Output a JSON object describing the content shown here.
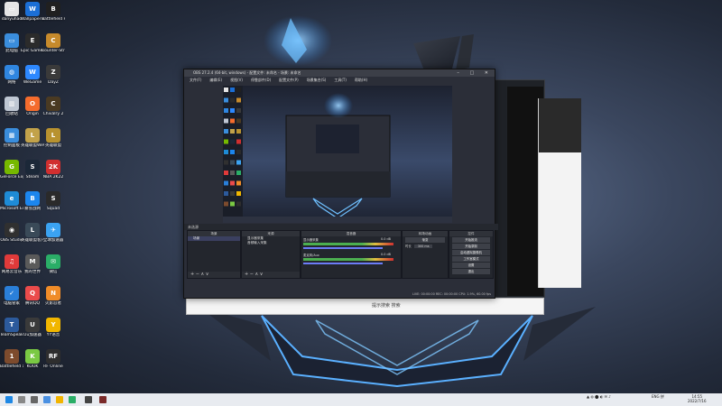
{
  "desktop": {
    "icons": [
      {
        "label": "danyuhao",
        "color": "#e5e5e5",
        "glyph": "▭"
      },
      {
        "label": "Wallpaper Engine",
        "color": "#1b6fd6",
        "glyph": "W"
      },
      {
        "label": "Battlefield Recruiter",
        "color": "#202020",
        "glyph": "B"
      },
      {
        "label": "此电脑",
        "color": "#3a8ddc",
        "glyph": "▭"
      },
      {
        "label": "Epic Games Launcher",
        "color": "#2b2b2b",
        "glyph": "E"
      },
      {
        "label": "Counter-Strike Global Off",
        "color": "#c68a2c",
        "glyph": "C"
      },
      {
        "label": "网络",
        "color": "#2f86e0",
        "glyph": "◍"
      },
      {
        "label": "WeGame",
        "color": "#2d88ff",
        "glyph": "W"
      },
      {
        "label": "DayZ",
        "color": "#3a3a3a",
        "glyph": "Z"
      },
      {
        "label": "回收站",
        "color": "#bfc7d3",
        "glyph": "▥"
      },
      {
        "label": "Origin",
        "color": "#f56c2d",
        "glyph": "O"
      },
      {
        "label": "Chivalry 2",
        "color": "#4a3a22",
        "glyph": "C"
      },
      {
        "label": "控制面板",
        "color": "#3a8ddc",
        "glyph": "▦"
      },
      {
        "label": "英雄联盟WeGame版",
        "color": "#c2a24a",
        "glyph": "L"
      },
      {
        "label": "英雄联盟",
        "color": "#b8922f",
        "glyph": "L"
      },
      {
        "label": "GeForce Experience",
        "color": "#76b900",
        "glyph": "G"
      },
      {
        "label": "Steam",
        "color": "#1b2838",
        "glyph": "S"
      },
      {
        "label": "NBA 2K22",
        "color": "#d12f2f",
        "glyph": "2K"
      },
      {
        "label": "Microsoft Edge",
        "color": "#1e8bd6",
        "glyph": "e"
      },
      {
        "label": "暴雪战网",
        "color": "#1c86ee",
        "glyph": "B"
      },
      {
        "label": "Squad",
        "color": "#2a2a2a",
        "glyph": "S"
      },
      {
        "label": "OBS Studio",
        "color": "#303030",
        "glyph": "◉"
      },
      {
        "label": "英雄联盟客户端",
        "color": "#3a4a58",
        "glyph": "L"
      },
      {
        "label": "全球加速器",
        "color": "#3ba3f2",
        "glyph": "✈"
      },
      {
        "label": "网易云音乐",
        "color": "#e03a3a",
        "glyph": "♫"
      },
      {
        "label": "我的世界",
        "color": "#5a5a5a",
        "glyph": "M"
      },
      {
        "label": "微信",
        "color": "#2aae67",
        "glyph": "✉"
      },
      {
        "label": "电脑管家",
        "color": "#2a7fd9",
        "glyph": "✓"
      },
      {
        "label": "腾讯QQ",
        "color": "#eb4b4b",
        "glyph": "Q"
      },
      {
        "label": "火影忍者",
        "color": "#f08c28",
        "glyph": "N"
      },
      {
        "label": "TeamSpeak 3",
        "color": "#2c5a9c",
        "glyph": "T"
      },
      {
        "label": "Uu加速器",
        "color": "#3a3a3a",
        "glyph": "U"
      },
      {
        "label": "YY语音",
        "color": "#f1b600",
        "glyph": "Y"
      },
      {
        "label": "Battlefield 1",
        "color": "#7d4b2d",
        "glyph": "1"
      },
      {
        "label": "KOOK",
        "color": "#7ac943",
        "glyph": "K"
      },
      {
        "label": "RF Online",
        "color": "#2e2e2e",
        "glyph": "RF"
      }
    ]
  },
  "obs": {
    "title": "OBS 27.2.4 (64-bit, windows) - 配置文件: 未命名 - 场景: 未命名",
    "menu": [
      "文件(F)",
      "编辑(E)",
      "视图(V)",
      "停靠部件(D)",
      "配置文件(P)",
      "场景集合(S)",
      "工具(T)",
      "帮助(H)"
    ],
    "scenes_dock_title": "未选源",
    "docks": {
      "scenes": {
        "title": "场景",
        "items": [
          "场景"
        ]
      },
      "sources": {
        "title": "来源",
        "items": [
          "显示器采集",
          "音频输入采集"
        ]
      },
      "mixer": {
        "title": "混音器",
        "channels": [
          {
            "name": "显示器采集",
            "db": "0.0 dB"
          },
          {
            "name": "麦克风/Aux",
            "db": "0.0 dB"
          }
        ]
      },
      "transitions": {
        "title": "转场动画",
        "type": "渐变",
        "duration_label": "时长",
        "duration": "300 ms"
      },
      "controls": {
        "title": "控件",
        "buttons": [
          "开始推流",
          "开始录制",
          "启动虚拟摄像机",
          "工作室模式",
          "设置",
          "退出"
        ]
      }
    },
    "footer_symbols": "+  −  ∧  ∨",
    "status": "LIVE: 00:00:00   REC: 00:00:00   CPU: 1.9%, 60.00 fps"
  },
  "browser_search": "提示搜索 搜索",
  "taskbar": {
    "start_icon": "windows-start-icon",
    "clock_time": "14:55",
    "clock_date": "2022/7/16",
    "tray_text": "ENG 拼"
  },
  "colors": {
    "accent": "#6b7cf7",
    "obs_bg": "#2b2e38",
    "taskbar": "#e8ebf0"
  }
}
